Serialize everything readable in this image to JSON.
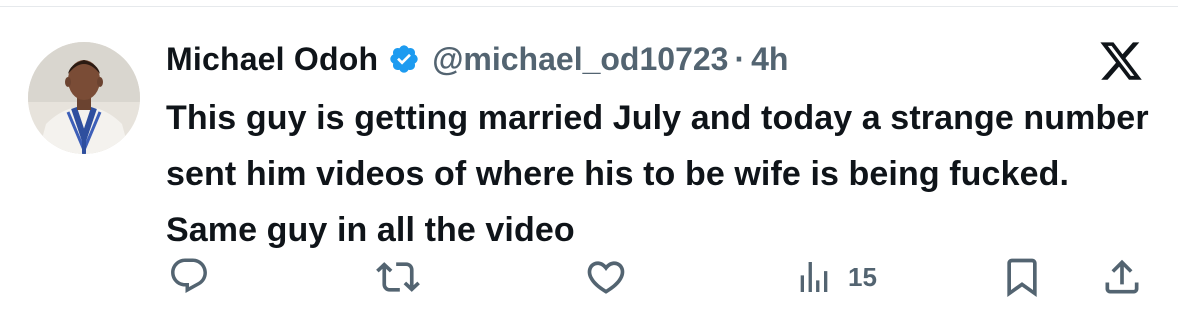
{
  "author": {
    "display_name": "Michael Odoh",
    "handle": "@michael_od10723",
    "separator": "·",
    "time": "4h",
    "verified": true
  },
  "tweet": {
    "text": "This guy is getting married July and today a strange number sent him videos of where his to be wife is being fucked. Same guy in all the video"
  },
  "actions": {
    "views_count": "15"
  },
  "icons": {
    "verified": "verified-badge-icon",
    "platform": "x-logo-icon",
    "reply": "reply-icon",
    "retweet": "retweet-icon",
    "like": "heart-icon",
    "views": "views-chart-icon",
    "bookmark": "bookmark-icon",
    "share": "share-icon"
  },
  "colors": {
    "text": "#0f1419",
    "muted": "#536471",
    "verified_blue": "#1d9bf0",
    "background": "#ffffff"
  }
}
